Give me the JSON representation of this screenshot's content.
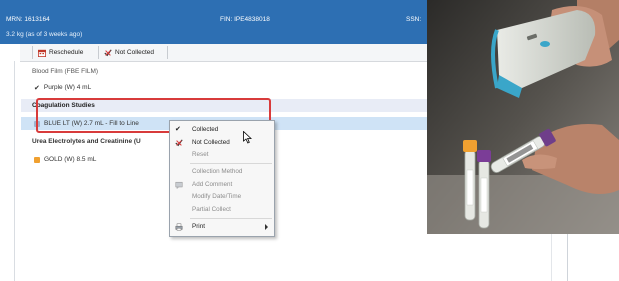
{
  "header": {
    "mrn": "MRN: 1613164",
    "fin": "FIN: IPE4838018",
    "ssn": "SSN:",
    "weight": "3.2 kg (as of 3 weeks ago)"
  },
  "toolbar": {
    "reschedule": "Reschedule",
    "not_collected": "Not Collected"
  },
  "list": {
    "group1": "Blood Film (FBE FILM)",
    "spec1": "Purple (W) 4 mL",
    "group2": "Coagulation Studies",
    "spec2": "BLUE LT (W) 2.7 mL - Fill to Line",
    "group3": "Urea Electrolytes and Creatinine (U",
    "spec3": "GOLD (W) 8.5 mL"
  },
  "context_menu": {
    "items": [
      {
        "label": "Collected"
      },
      {
        "label": "Not Collected"
      },
      {
        "label": "Reset"
      },
      {
        "label": "Collection Method"
      },
      {
        "label": "Add Comment"
      },
      {
        "label": "Modify Date/Time"
      },
      {
        "label": "Partial Collect"
      },
      {
        "label": "Print"
      }
    ]
  },
  "colors": {
    "header_blue": "#2d6fb3",
    "highlight_red": "#d83b3b",
    "selected_row": "#cfe3f6",
    "tube_orange": "#f0a030"
  },
  "icons": [
    "reschedule-icon",
    "not-collected-icon",
    "checkmark-icon",
    "tube-icon",
    "add-comment-icon",
    "print-icon",
    "submenu-arrow-icon",
    "mouse-cursor-icon"
  ]
}
